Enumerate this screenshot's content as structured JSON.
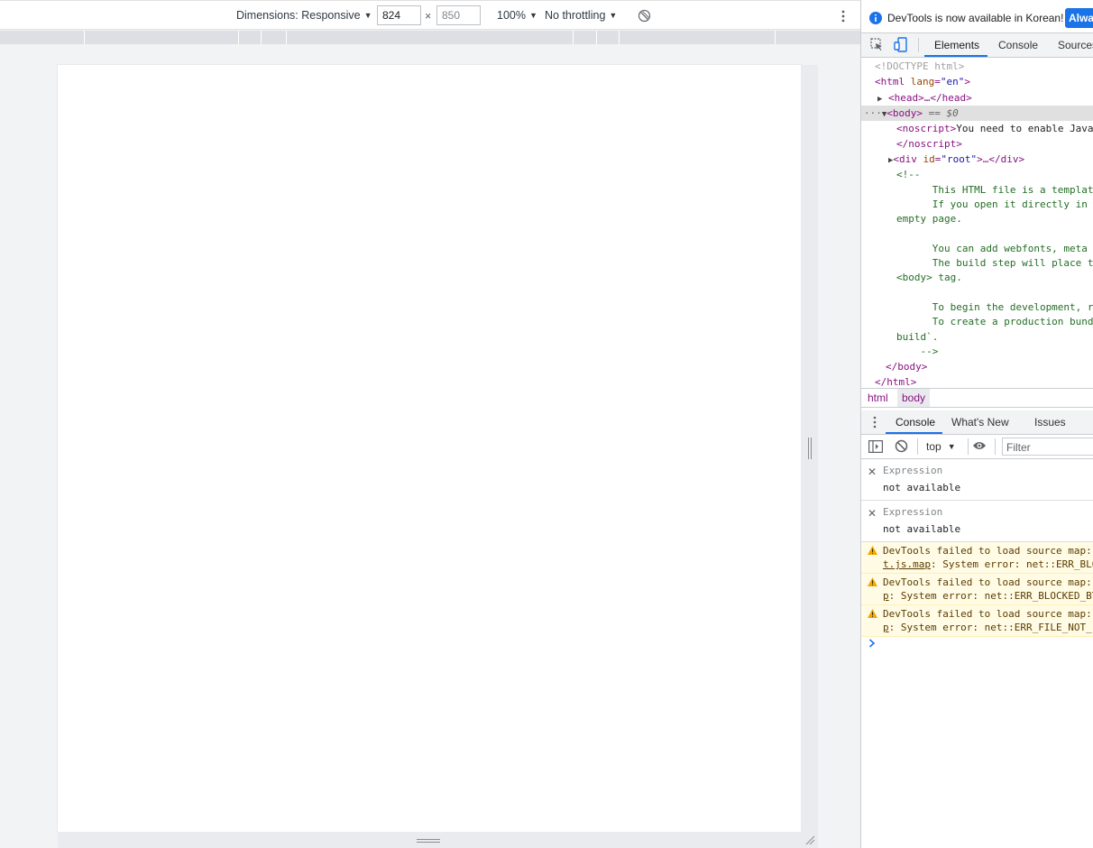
{
  "device_toolbar": {
    "dimensions_label": "Dimensions: Responsive",
    "width_value": "824",
    "height_value": "850",
    "times": "×",
    "zoom": "100%",
    "throttling": "No throttling",
    "rotate_icon": "rotate-icon",
    "more_icon": "more-vert-icon"
  },
  "infobar": {
    "info_icon": "info-icon",
    "message": "DevTools is now available in Korean!",
    "button": "Alway"
  },
  "main_tabs": {
    "inspect_icon": "inspect-icon",
    "device_icon": "device-toggle-icon",
    "items": [
      "Elements",
      "Console",
      "Sources"
    ],
    "active": "Elements"
  },
  "elements": {
    "doctype": "<!DOCTYPE html>",
    "html_open_tag": "<html",
    "html_lang_attr": "lang",
    "html_lang_val": "\"en\"",
    "head": "<head>…</head>",
    "body_open": "<body>",
    "body_eq": " == $0",
    "noscript_open": "<noscript>",
    "noscript_text": "You need to enable Javascript",
    "noscript_close": "</noscript>",
    "div_open": "<div",
    "div_attr": "id",
    "div_val": "\"root\"",
    "div_rest": ">…</div>",
    "comment_lines": [
      "<!--",
      "      This HTML file is a template.",
      "      If you open it directly in the browser, you will see an",
      "empty page.",
      "",
      "      You can add webfonts, meta tags, or analytics to this file.",
      "      The build step will place the bundled scripts into the",
      "<body> tag.",
      "",
      "      To begin the development, run `npm start` or `yarn start`.",
      "      To create a production bundle, use `npm run build` or `yarn",
      "build`.",
      "    -->"
    ],
    "body_close": "</body>",
    "html_close": "</html>"
  },
  "breadcrumbs": [
    "html",
    "body"
  ],
  "drawer": {
    "menu_icon": "more-vert-icon",
    "tabs": [
      "Console",
      "What's New",
      "Issues"
    ],
    "active": "Console"
  },
  "console_toolbar": {
    "sidebar_icon": "sidebar-toggle-icon",
    "clear_icon": "clear-console-icon",
    "context": "top",
    "eye_icon": "live-expression-icon",
    "filter_placeholder": "Filter"
  },
  "live_expressions": [
    {
      "label": "Expression",
      "value": "not available"
    },
    {
      "label": "Expression",
      "value": "not available"
    }
  ],
  "warnings": [
    {
      "line1": "DevTools failed to load source map: Could not load content for",
      "line2_link": "t.js.map",
      "line2_rest": ": System error: net::ERR_BLOCKED_BY_CLIENT"
    },
    {
      "line1": "DevTools failed to load source map: Could not load content for",
      "line2_link": "p",
      "line2_rest": ": System error: net::ERR_BLOCKED_BY_CLIENT"
    },
    {
      "line1": "DevTools failed to load source map: Could not load content for",
      "line2_link": "p",
      "line2_rest": ": System error: net::ERR_FILE_NOT_FOUND"
    }
  ],
  "prompt_icon": "console-prompt-icon",
  "colors": {
    "accent": "#1a73e8",
    "warning_bg": "#fffbe5",
    "tag": "#881280",
    "comment": "#236e25"
  }
}
